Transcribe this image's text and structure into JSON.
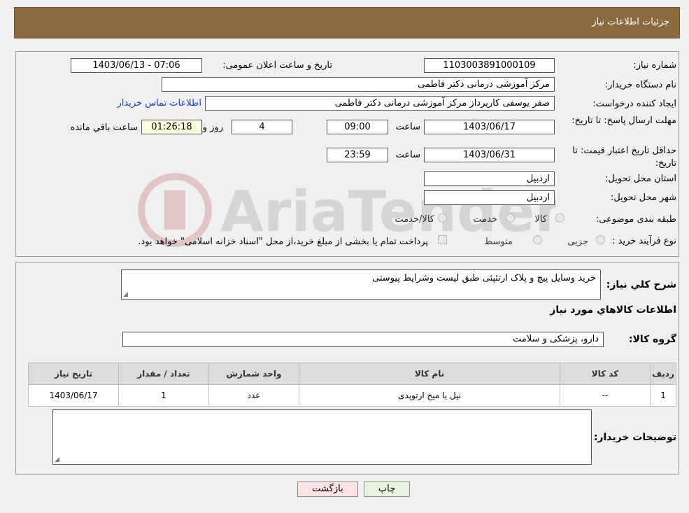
{
  "header": {
    "title": "جزئیات اطلاعات نیاز"
  },
  "watermark": {
    "text": "AriaTender.neT"
  },
  "form": {
    "need_number_label": "شماره نیاز:",
    "need_number": "1103003891000109",
    "announce_label": "تاریخ و ساعت اعلان عمومی:",
    "announce_value": "1403/06/13 - 07:06",
    "buyer_org_label": "نام دستگاه خریدار:",
    "buyer_org": "مرکز آموزشی درمانی دکتر فاطمی",
    "creator_label": "ایجاد کننده درخواست:",
    "creator": "صفر یوسفی کارپرداز مرکز آموزشی درمانی دکتر فاطمی",
    "contact_link": "اطلاعات تماس خریدار",
    "deadline_label": "مهلت ارسال پاسخ: تا تاریخ:",
    "deadline_date": "1403/06/17",
    "time_label": "ساعت",
    "deadline_time": "09:00",
    "days_value": "4",
    "days_label": "روز و",
    "remaining_time": "01:26:18",
    "remaining_label": "ساعت باقي مانده",
    "validity_label": "حداقل تاریخ اعتبار قیمت: تا تاریخ:",
    "validity_date": "1403/06/31",
    "validity_time": "23:59",
    "province_label": "استان محل تحویل:",
    "province": "اردبیل",
    "city_label": "شهر محل تحویل:",
    "city": "اردبیل",
    "category_label": "طبقه بندی موضوعی:",
    "category_options": [
      "کالا",
      "خدمت",
      "کالا/خدمت"
    ],
    "process_label": "نوع فرآیند خرید :",
    "process_options": [
      "جزیی",
      "متوسط"
    ],
    "payment_note": "پرداخت تمام یا بخشی از مبلغ خرید،از محل \"اسناد خزانه اسلامی\" خواهد بود."
  },
  "details": {
    "summary_label": "شرح کلي نياز:",
    "summary": "خرید وسایل پیچ و پلاک ارتئپئی طبق لیست وشرایط پیوستی",
    "goods_info_title": "اطلاعات کالاهاي مورد نياز",
    "goods_group_label": "گروه کالا:",
    "goods_group": "دارو، پزشکی و سلامت",
    "table": {
      "headers": [
        "رديف",
        "کد کالا",
        "نام کالا",
        "واحد شمارش",
        "تعداد / مقدار",
        "تاریخ نیاز"
      ],
      "rows": [
        [
          "1",
          "--",
          "نیل یا میخ ارتوپدی",
          "عدد",
          "1",
          "1403/06/17"
        ]
      ]
    },
    "buyer_notes_label": "توضیحات خریدار:",
    "buyer_notes": ""
  },
  "buttons": {
    "print": "چاپ",
    "back": "بازگشت"
  }
}
